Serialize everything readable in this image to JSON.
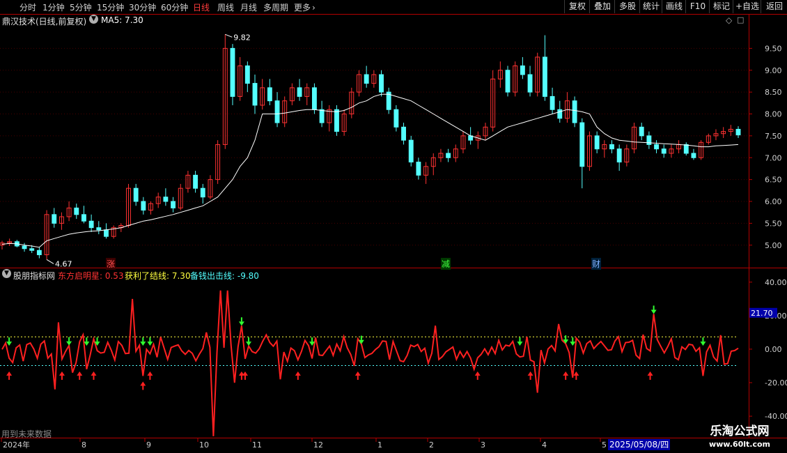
{
  "toolbar": {
    "timeframes": [
      "分时",
      "1分钟",
      "5分钟",
      "15分钟",
      "30分钟",
      "60分钟",
      "日线",
      "周线",
      "月线",
      "多周期",
      "更多"
    ],
    "active_timeframe": "日线",
    "more_icon": "chevron-right-icon",
    "buttons": [
      "复权",
      "叠加",
      "多股",
      "统计",
      "画线",
      "F10",
      "标记",
      "+自选",
      "返回"
    ]
  },
  "main_header": {
    "title": "鼎汉技术(日线,前复权)",
    "ma_label": "MA5: 7.30",
    "icon": "chevron-down-circle-icon",
    "diamond_icon": "diamond-icon"
  },
  "sub_header": {
    "title": "股朋指标网",
    "line1": "东方启明星: 0.53",
    "line2": "获利了结线: 7.30",
    "line3": "备钱出击线: -9.80"
  },
  "markers": {
    "zhang": "涨",
    "jian": "减",
    "cai": "财"
  },
  "footer": {
    "note": "用到未来数据",
    "date_box": "2025/05/08/四"
  },
  "brand": {
    "line1": "乐淘公式网",
    "line2": "www.60lt.com"
  },
  "colors": {
    "up": "#ff3232",
    "down": "#54ffff",
    "ma": "#ffffff",
    "axis": "#b40000",
    "osc": "#ff2020",
    "dash_top": "#ffff40",
    "dash_bottom": "#54ffff",
    "text_green": "#54ffff",
    "text_yellow": "#ffff40"
  },
  "chart_data": [
    {
      "type": "candlestick",
      "title": "鼎汉技术(日线,前复权)",
      "y_ticks": [
        5.0,
        5.5,
        6.0,
        6.5,
        7.0,
        7.5,
        8.0,
        8.5,
        9.0,
        9.5
      ],
      "y_range": [
        4.55,
        10.0
      ],
      "x_ticks": [
        "2024年",
        "8",
        "9",
        "10",
        "11",
        "12",
        "1",
        "2",
        "3",
        "4",
        "5"
      ],
      "annotations": {
        "high": "9.82",
        "low": "4.67"
      },
      "series": [
        {
          "name": "MA5",
          "current": 7.3
        }
      ],
      "candles": [
        [
          5.0,
          5.1,
          4.9,
          5.05
        ],
        [
          5.05,
          5.15,
          4.98,
          5.08
        ],
        [
          5.08,
          5.12,
          4.95,
          4.98
        ],
        [
          4.98,
          5.05,
          4.85,
          4.92
        ],
        [
          4.92,
          5.0,
          4.82,
          4.88
        ],
        [
          4.88,
          4.95,
          4.7,
          4.78
        ],
        [
          4.78,
          5.8,
          4.67,
          5.7
        ],
        [
          5.7,
          5.85,
          5.4,
          5.5
        ],
        [
          5.5,
          5.75,
          5.35,
          5.65
        ],
        [
          5.65,
          6.0,
          5.55,
          5.85
        ],
        [
          5.85,
          5.95,
          5.6,
          5.7
        ],
        [
          5.7,
          5.9,
          5.5,
          5.55
        ],
        [
          5.55,
          5.7,
          5.3,
          5.4
        ],
        [
          5.4,
          5.55,
          5.25,
          5.35
        ],
        [
          5.35,
          5.5,
          5.15,
          5.2
        ],
        [
          5.2,
          5.45,
          5.15,
          5.4
        ],
        [
          5.4,
          5.5,
          5.3,
          5.45
        ],
        [
          5.45,
          6.4,
          5.4,
          6.3
        ],
        [
          6.3,
          6.4,
          5.9,
          6.0
        ],
        [
          6.0,
          6.1,
          5.7,
          5.8
        ],
        [
          5.8,
          6.0,
          5.7,
          5.95
        ],
        [
          5.95,
          6.2,
          5.85,
          6.1
        ],
        [
          6.1,
          6.3,
          5.9,
          6.0
        ],
        [
          6.0,
          6.1,
          5.75,
          5.85
        ],
        [
          5.85,
          6.4,
          5.8,
          6.3
        ],
        [
          6.3,
          6.7,
          6.2,
          6.6
        ],
        [
          6.6,
          6.7,
          6.2,
          6.3
        ],
        [
          6.3,
          6.4,
          5.95,
          6.1
        ],
        [
          6.1,
          6.6,
          6.05,
          6.5
        ],
        [
          6.5,
          7.4,
          6.4,
          7.3
        ],
        [
          7.3,
          9.82,
          7.2,
          9.5
        ],
        [
          9.5,
          9.6,
          8.2,
          8.4
        ],
        [
          8.4,
          9.3,
          8.3,
          9.1
        ],
        [
          9.1,
          9.2,
          8.5,
          8.7
        ],
        [
          8.7,
          8.9,
          8.0,
          8.2
        ],
        [
          8.2,
          8.8,
          8.1,
          8.6
        ],
        [
          8.6,
          8.8,
          8.2,
          8.3
        ],
        [
          8.3,
          8.5,
          7.7,
          7.8
        ],
        [
          7.8,
          8.4,
          7.7,
          8.3
        ],
        [
          8.3,
          8.7,
          8.2,
          8.6
        ],
        [
          8.6,
          8.8,
          8.3,
          8.4
        ],
        [
          8.4,
          8.7,
          8.2,
          8.6
        ],
        [
          8.6,
          8.7,
          8.0,
          8.1
        ],
        [
          8.1,
          8.3,
          7.7,
          7.8
        ],
        [
          7.8,
          8.2,
          7.6,
          8.1
        ],
        [
          8.1,
          8.2,
          7.5,
          7.6
        ],
        [
          7.6,
          8.1,
          7.5,
          8.0
        ],
        [
          8.0,
          8.6,
          7.9,
          8.5
        ],
        [
          8.5,
          9.0,
          8.4,
          8.9
        ],
        [
          8.9,
          9.1,
          8.6,
          8.7
        ],
        [
          8.7,
          9.0,
          8.6,
          8.9
        ],
        [
          8.9,
          9.0,
          8.4,
          8.5
        ],
        [
          8.5,
          8.6,
          8.0,
          8.1
        ],
        [
          8.1,
          8.2,
          7.6,
          7.7
        ],
        [
          7.7,
          7.8,
          7.3,
          7.4
        ],
        [
          7.4,
          7.5,
          6.8,
          6.9
        ],
        [
          6.9,
          7.0,
          6.5,
          6.6
        ],
        [
          6.6,
          6.9,
          6.4,
          6.8
        ],
        [
          6.8,
          7.1,
          6.6,
          7.0
        ],
        [
          7.0,
          7.2,
          6.9,
          7.1
        ],
        [
          7.1,
          7.2,
          6.9,
          7.0
        ],
        [
          7.0,
          7.3,
          6.9,
          7.2
        ],
        [
          7.2,
          7.6,
          7.1,
          7.5
        ],
        [
          7.5,
          7.7,
          7.3,
          7.4
        ],
        [
          7.4,
          7.6,
          7.2,
          7.5
        ],
        [
          7.5,
          7.8,
          7.4,
          7.7
        ],
        [
          7.7,
          9.0,
          7.6,
          8.8
        ],
        [
          8.8,
          9.2,
          8.6,
          9.0
        ],
        [
          9.0,
          9.1,
          8.4,
          8.5
        ],
        [
          8.5,
          9.2,
          8.4,
          9.1
        ],
        [
          9.1,
          9.3,
          8.8,
          8.9
        ],
        [
          8.9,
          9.1,
          8.4,
          8.5
        ],
        [
          8.5,
          9.4,
          8.4,
          9.3
        ],
        [
          9.3,
          9.8,
          8.3,
          8.4
        ],
        [
          8.4,
          8.6,
          8.0,
          8.1
        ],
        [
          8.1,
          8.3,
          7.8,
          7.9
        ],
        [
          7.9,
          8.5,
          7.8,
          8.3
        ],
        [
          8.3,
          8.4,
          7.7,
          7.8
        ],
        [
          7.8,
          7.9,
          6.3,
          6.8
        ],
        [
          6.8,
          7.6,
          6.7,
          7.5
        ],
        [
          7.5,
          7.6,
          7.1,
          7.2
        ],
        [
          7.2,
          7.4,
          7.0,
          7.3
        ],
        [
          7.3,
          7.4,
          7.1,
          7.2
        ],
        [
          7.2,
          7.3,
          6.7,
          6.9
        ],
        [
          6.9,
          7.3,
          6.8,
          7.2
        ],
        [
          7.2,
          7.8,
          7.1,
          7.7
        ],
        [
          7.7,
          7.8,
          7.4,
          7.5
        ],
        [
          7.5,
          7.6,
          7.2,
          7.3
        ],
        [
          7.3,
          7.4,
          7.1,
          7.2
        ],
        [
          7.2,
          7.3,
          7.0,
          7.1
        ],
        [
          7.1,
          7.3,
          7.0,
          7.2
        ],
        [
          7.2,
          7.4,
          7.1,
          7.3
        ],
        [
          7.3,
          7.35,
          7.05,
          7.1
        ],
        [
          7.1,
          7.2,
          6.95,
          7.0
        ],
        [
          7.0,
          7.4,
          6.95,
          7.35
        ],
        [
          7.35,
          7.55,
          7.3,
          7.5
        ],
        [
          7.5,
          7.65,
          7.4,
          7.55
        ],
        [
          7.55,
          7.7,
          7.45,
          7.6
        ],
        [
          7.6,
          7.75,
          7.5,
          7.65
        ],
        [
          7.65,
          7.72,
          7.45,
          7.52
        ]
      ],
      "ma": [
        5.02,
        5.04,
        5.03,
        5.0,
        4.98,
        4.95,
        5.1,
        5.15,
        5.2,
        5.25,
        5.28,
        5.3,
        5.32,
        5.33,
        5.35,
        5.37,
        5.4,
        5.45,
        5.5,
        5.55,
        5.58,
        5.62,
        5.66,
        5.7,
        5.75,
        5.8,
        5.85,
        5.9,
        6.0,
        6.1,
        6.3,
        6.5,
        6.8,
        7.0,
        7.4,
        8.0,
        8.0,
        8.0,
        8.02,
        8.05,
        8.08,
        8.1,
        8.1,
        8.08,
        8.06,
        8.05,
        8.08,
        8.15,
        8.25,
        8.3,
        8.4,
        8.45,
        8.45,
        8.4,
        8.35,
        8.3,
        8.2,
        8.1,
        8.0,
        7.9,
        7.8,
        7.7,
        7.6,
        7.5,
        7.45,
        7.4,
        7.5,
        7.6,
        7.7,
        7.75,
        7.8,
        7.85,
        7.9,
        7.95,
        8.0,
        8.05,
        8.1,
        8.08,
        8.05,
        8.0,
        7.7,
        7.55,
        7.45,
        7.4,
        7.38,
        7.36,
        7.35,
        7.34,
        7.33,
        7.32,
        7.31,
        7.3,
        7.29,
        7.27,
        7.25,
        7.25,
        7.27,
        7.28,
        7.29,
        7.3
      ]
    },
    {
      "type": "line",
      "title": "股朋指标网",
      "y_ticks": [
        40.0,
        20.0,
        0.0,
        -20.0,
        -40.0
      ],
      "y_range": [
        -52,
        42
      ],
      "current_badge": "21.70",
      "reference_lines": [
        {
          "name": "获利了结线",
          "value": 7.3
        },
        {
          "name": "备钱出击线",
          "value": -9.8
        }
      ],
      "series": [
        {
          "name": "东方启明星",
          "current": 0.53
        }
      ],
      "buy_arrows": [
        2,
        17,
        22,
        26,
        40,
        42,
        68,
        69,
        84,
        101,
        135,
        150,
        160,
        163,
        184
      ],
      "sell_arrows": [
        2,
        19,
        24,
        27,
        40,
        42,
        68,
        70,
        88,
        102,
        147,
        160,
        162,
        185,
        199
      ]
    }
  ]
}
